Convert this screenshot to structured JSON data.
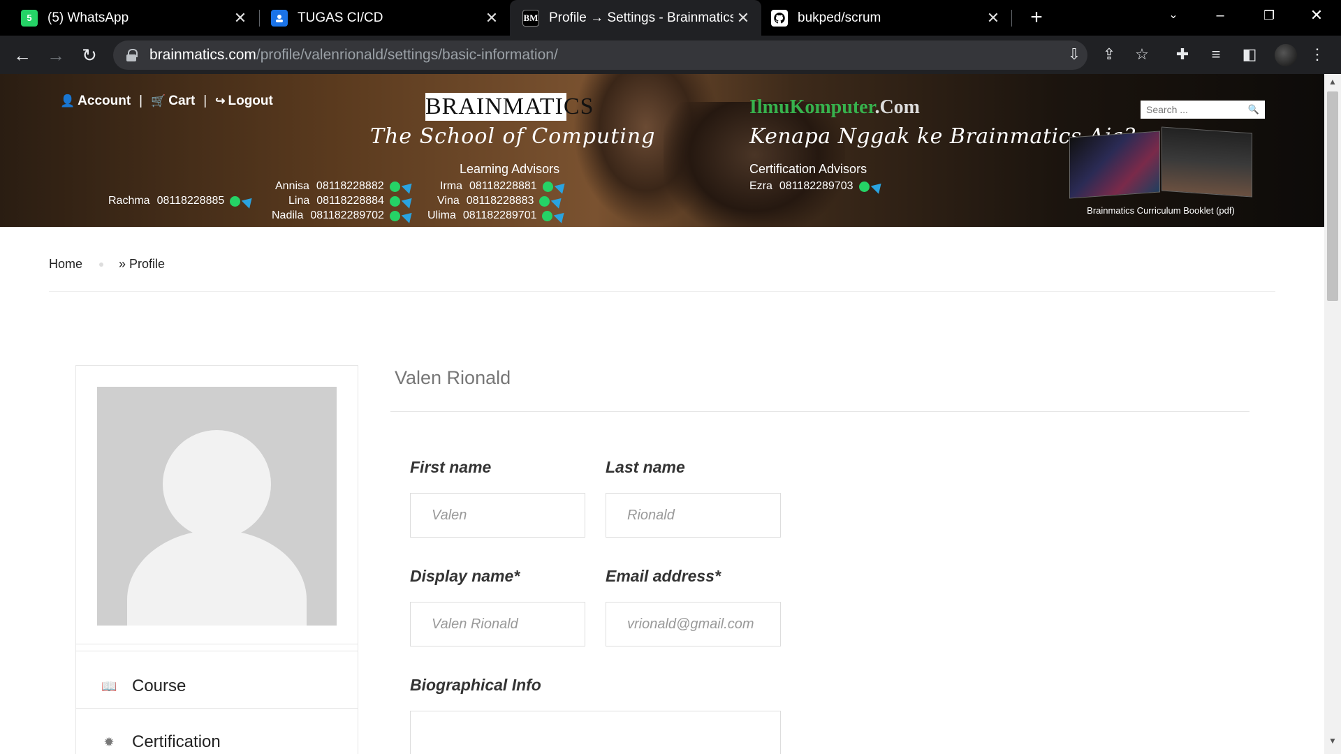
{
  "tabs": [
    {
      "title": "(5) WhatsApp",
      "icon": "whatsapp-icon",
      "close": "✕"
    },
    {
      "title": "TUGAS CI/CD",
      "icon": "classroom-icon",
      "close": "✕"
    },
    {
      "title": "Profile → Settings - Brainmatics",
      "icon": "brainmatics-icon",
      "close": "✕",
      "active": true
    },
    {
      "title": "bukped/scrum",
      "icon": "github-icon",
      "close": "✕"
    }
  ],
  "tab_favicons": {
    "whatsapp": "5",
    "brainmatics": "BM"
  },
  "address_bar": {
    "host": "brainmatics.com",
    "path": "/profile/valenrionald/settings/basic-information/"
  },
  "banner": {
    "account": "Account",
    "cart": "Cart",
    "logout": "Logout",
    "separator": "|",
    "logo": "BRAINMATICS",
    "tagline_left": "The School of Computing",
    "learning_advisors_heading": "Learning Advisors",
    "learning_advisors": [
      {
        "name": "Annisa",
        "phone": "08118228882"
      },
      {
        "name": "Irma",
        "phone": "08118228881"
      },
      {
        "name": "Lina",
        "phone": "08118228884"
      },
      {
        "name": "Vina",
        "phone": "08118228883"
      },
      {
        "name": "Nadila",
        "phone": "081182289702"
      },
      {
        "name": "Ulima",
        "phone": "081182289701"
      },
      {
        "name": "Rachma",
        "phone": "08118228885"
      }
    ],
    "ilmu_green": "IlmuKomputer",
    "ilmu_white": ".Com",
    "tagline_right": "Kenapa Nggak ke Brainmatics Aja?",
    "certification_heading": "Certification Advisors",
    "certification_advisors": [
      {
        "name": "Ezra",
        "phone": "081182289703"
      }
    ],
    "search_placeholder": "Search ...",
    "booklet_caption": "Brainmatics Curriculum Booklet (pdf)"
  },
  "breadcrumb": {
    "home": "Home",
    "current": "» Profile"
  },
  "profile": {
    "display_name": "Valen Rionald",
    "menu": [
      {
        "label": "Course",
        "icon": "book-icon"
      },
      {
        "label": "Certification",
        "icon": "certificate-icon"
      }
    ]
  },
  "form": {
    "first_name_label": "First name",
    "first_name_placeholder": "Valen",
    "last_name_label": "Last name",
    "last_name_placeholder": "Rionald",
    "display_name_label": "Display name*",
    "display_name_placeholder": "Valen Rionald",
    "email_label": "Email address*",
    "email_placeholder": "vrionald@gmail.com",
    "bio_label": "Biographical Info"
  }
}
